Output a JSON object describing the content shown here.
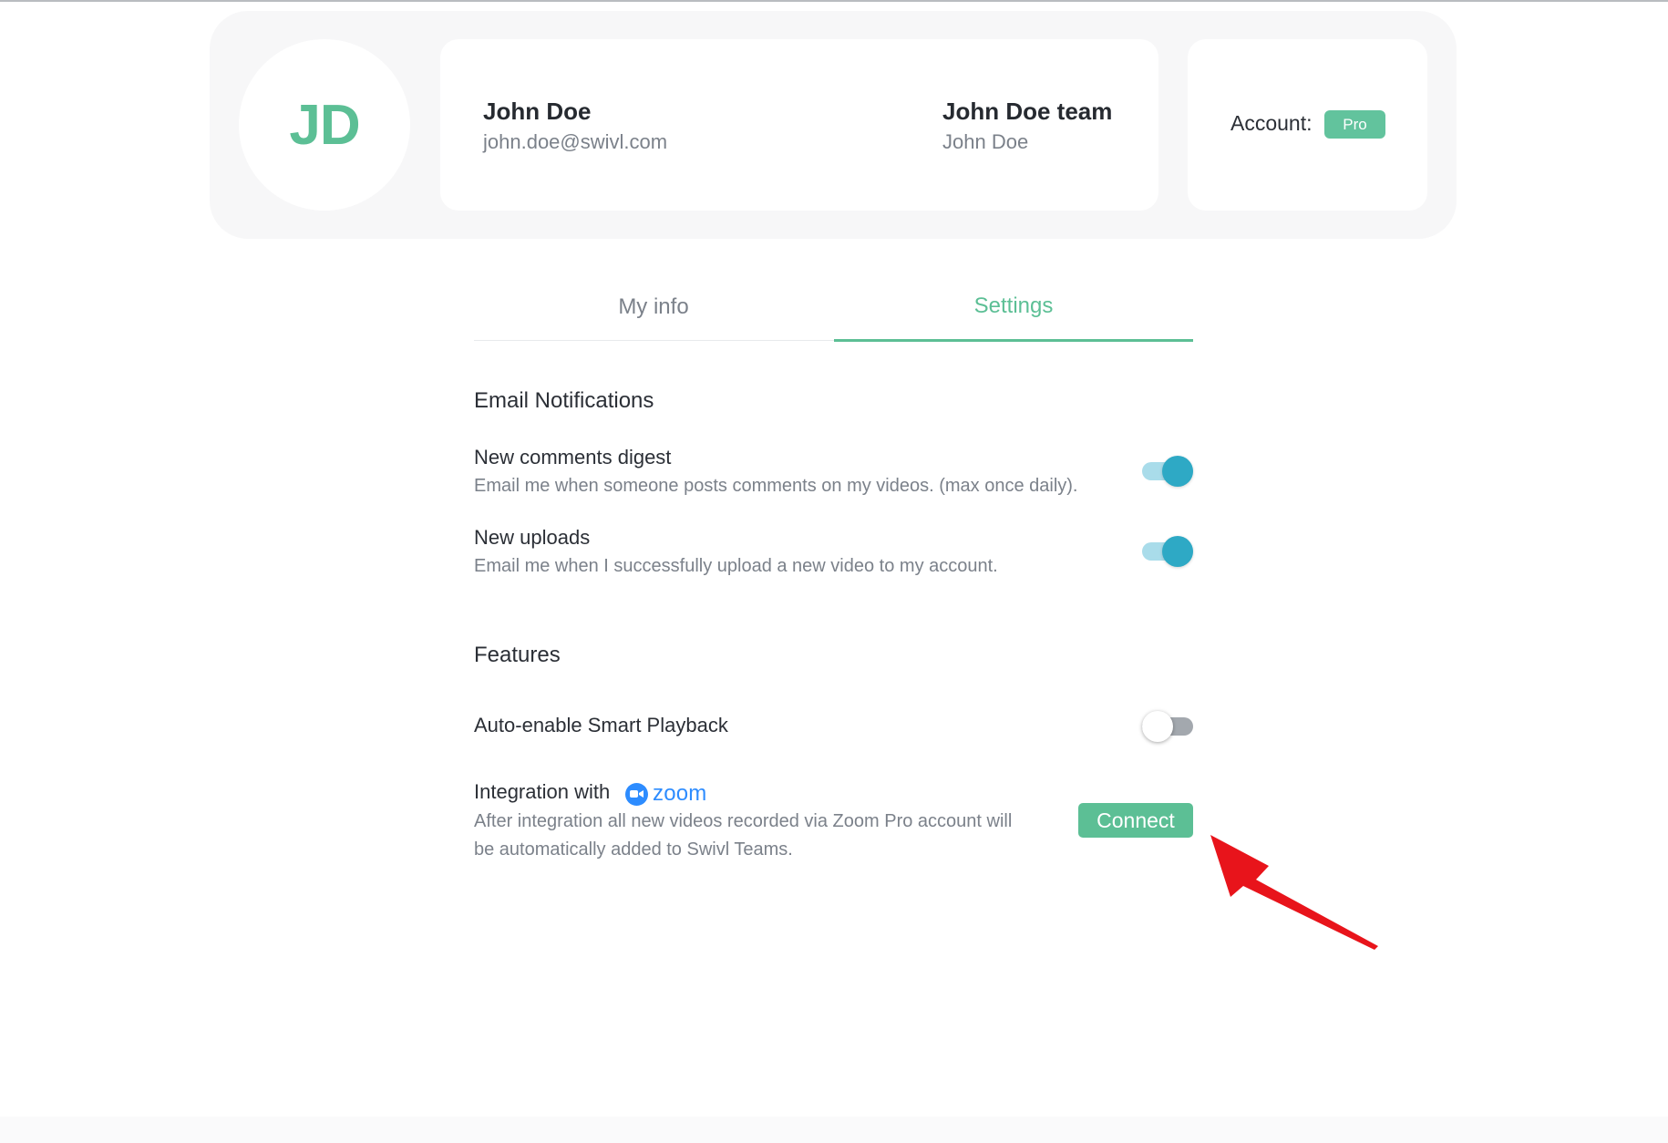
{
  "profile": {
    "initials": "JD",
    "name": "John Doe",
    "email": "john.doe@swivl.com",
    "team_name": "John Doe team",
    "team_owner": "John Doe",
    "account_label": "Account:",
    "account_type": "Pro"
  },
  "tabs": [
    {
      "label": "My info",
      "active": false
    },
    {
      "label": "Settings",
      "active": true
    }
  ],
  "email_notifications": {
    "title": "Email Notifications",
    "items": [
      {
        "title": "New comments digest",
        "description": "Email me when someone posts comments on my videos. (max once daily).",
        "enabled": true
      },
      {
        "title": "New uploads",
        "description": "Email me when I successfully upload a new video to my account.",
        "enabled": true
      }
    ]
  },
  "features": {
    "title": "Features",
    "smart_playback": {
      "title": "Auto-enable Smart Playback",
      "enabled": false
    },
    "zoom_integration": {
      "title": "Integration with",
      "logo_text": "zoom",
      "description_line1": "After integration all new videos recorded via Zoom Pro account will",
      "description_line2": "be automatically added to Swivl Teams.",
      "button_label": "Connect"
    }
  },
  "colors": {
    "accent_green": "#5cbf95",
    "toggle_on": "#2ea9c5",
    "zoom_blue": "#2d8cff",
    "annotation_arrow": "#e8141b"
  },
  "icons": {
    "zoom_mark": "zoom-camera-icon",
    "annotation": "red-arrow-annotation"
  }
}
